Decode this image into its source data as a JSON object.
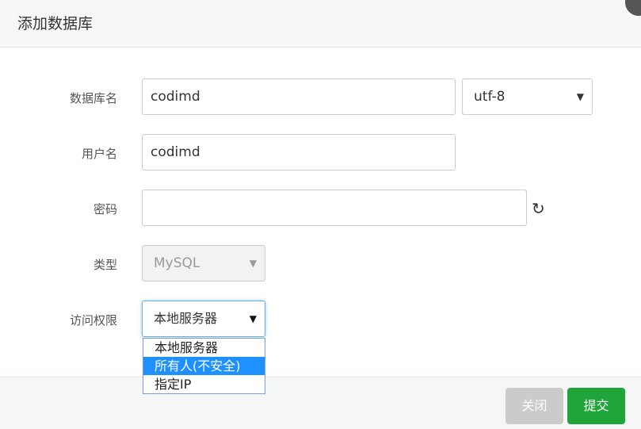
{
  "dialog": {
    "title": "添加数据库"
  },
  "form": {
    "db_name": {
      "label": "数据库名",
      "value": "codimd",
      "charset": "utf-8"
    },
    "username": {
      "label": "用户名",
      "value": "codimd"
    },
    "password": {
      "label": "密码",
      "value": ""
    },
    "type": {
      "label": "类型",
      "value": "MySQL"
    },
    "access": {
      "label": "访问权限",
      "value": "本地服务器",
      "options": [
        "本地服务器",
        "所有人(不安全)",
        "指定IP"
      ],
      "highlighted": "所有人(不安全)"
    }
  },
  "buttons": {
    "close": "关闭",
    "submit": "提交"
  },
  "colors": {
    "submit": "#20a53a",
    "close": "#cbcbcb",
    "highlight": "#1e90ff"
  }
}
